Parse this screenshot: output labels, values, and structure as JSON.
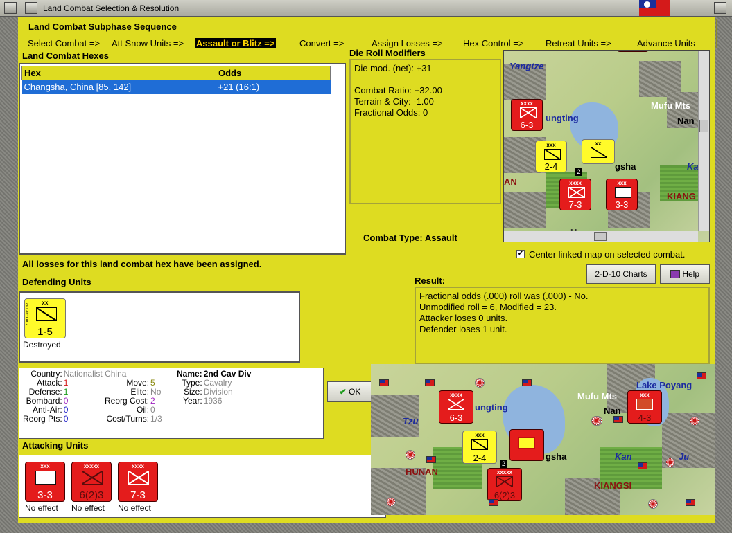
{
  "window": {
    "title": "Land Combat Selection & Resolution"
  },
  "subphase": {
    "title": "Land Combat Subphase Sequence",
    "steps": [
      {
        "label": "Select Combat =>",
        "active": false
      },
      {
        "label": "Att Snow Units =>",
        "active": false
      },
      {
        "label": "Assault or Blitz =>",
        "active": true
      },
      {
        "label": "Convert =>",
        "active": false
      },
      {
        "label": "Assign Losses =>",
        "active": false
      },
      {
        "label": "Hex Control =>",
        "active": false
      },
      {
        "label": "Retreat Units =>",
        "active": false
      },
      {
        "label": "Advance Units",
        "active": false
      }
    ]
  },
  "hexes": {
    "title": "Land Combat Hexes",
    "columns": [
      "Hex",
      "Odds"
    ],
    "rows": [
      {
        "hex": "Changsha, China [85, 142]",
        "odds": "+21 (16:1)"
      }
    ]
  },
  "modifiers": {
    "title": "Die Roll Modifiers",
    "lines": [
      "Die mod. (net): +31",
      "",
      "Combat Ratio: +32.00",
      "Terrain & City: -1.00",
      "Fractional Odds: 0"
    ]
  },
  "combat_type": {
    "label": "Combat Type:",
    "value": "Assault"
  },
  "map_labels": {
    "small": [
      "Yangtze",
      "Mufu Mts",
      "Nan",
      "ungting",
      "gsha",
      "Ka",
      "AN",
      "KIANG",
      "Hengyang"
    ],
    "large": [
      "Mufu Mts",
      "Lake Poyang",
      "Nan",
      "ungting",
      "Tzu",
      "gsha",
      "Kan",
      "Ju",
      "HUNAN",
      "KIANGSI"
    ]
  },
  "center_linked": {
    "label": "Center linked map on selected combat.",
    "checked": true
  },
  "buttons": {
    "charts": "2-D-10 Charts",
    "help": "Help",
    "ok": "OK"
  },
  "losses_message": "All losses for this land combat hex have been assigned.",
  "defending": {
    "title": "Defending Units",
    "units": [
      {
        "name": "2nd Cav Div",
        "size": "xx",
        "stats": "1-5",
        "status": "Destroyed"
      }
    ]
  },
  "result": {
    "title": "Result:",
    "lines": [
      "Fractional odds (.000) roll was (.000)  - No.",
      "Unmodified roll = 6, Modified = 23.",
      "Attacker loses 0 units.",
      "Defender loses 1 unit."
    ]
  },
  "unit_info": {
    "country_label": "Country:",
    "country": "Nationalist China",
    "attack_label": "Attack:",
    "attack": "1",
    "defense_label": "Defense:",
    "defense": "1",
    "bombard_label": "Bombard:",
    "bombard": "0",
    "antiair_label": "Anti-Air:",
    "antiair": "0",
    "reorg_pts_label": "Reorg Pts:",
    "reorg_pts": "0",
    "move_label": "Move:",
    "move": "5",
    "elite_label": "Elite:",
    "elite": "No",
    "reorg_cost_label": "Reorg Cost:",
    "reorg_cost": "2",
    "oil_label": "Oil:",
    "oil": "0",
    "cost_turns_label": "Cost/Turns:",
    "cost_turns": "1/3",
    "name_label": "Name:",
    "name": "2nd Cav Div",
    "type_label": "Type:",
    "type": "Cavalry",
    "size_label": "Size:",
    "size": "Division",
    "year_label": "Year:",
    "year": "1936"
  },
  "attacking": {
    "title": "Attacking Units",
    "units": [
      {
        "stats": "3-3",
        "status": "No effect",
        "size": "xxx"
      },
      {
        "stats": "6(2)3",
        "status": "No effect",
        "size": "xxxxx"
      },
      {
        "stats": "7-3",
        "status": "No effect",
        "size": "xxxx"
      }
    ]
  },
  "counters": {
    "sm_63": "6-3",
    "sm_24": "2-4",
    "sm_73": "7-3",
    "sm_33": "3-3",
    "sm_def": "1-5",
    "lg_63": "6-3",
    "lg_24": "2-4",
    "lg_623": "6(2)3",
    "lg_43": "4-3",
    "size_xxxx": "xxxx",
    "size_xxx": "xxx",
    "size_xx": "xx",
    "size_xxxxx": "xxxxx",
    "stack_2": "2"
  },
  "colors": {
    "panel": "#dedc21",
    "selection": "#1f6dd6",
    "counter_red": "#e41c1c",
    "counter_yellow": "#fffb2a"
  }
}
